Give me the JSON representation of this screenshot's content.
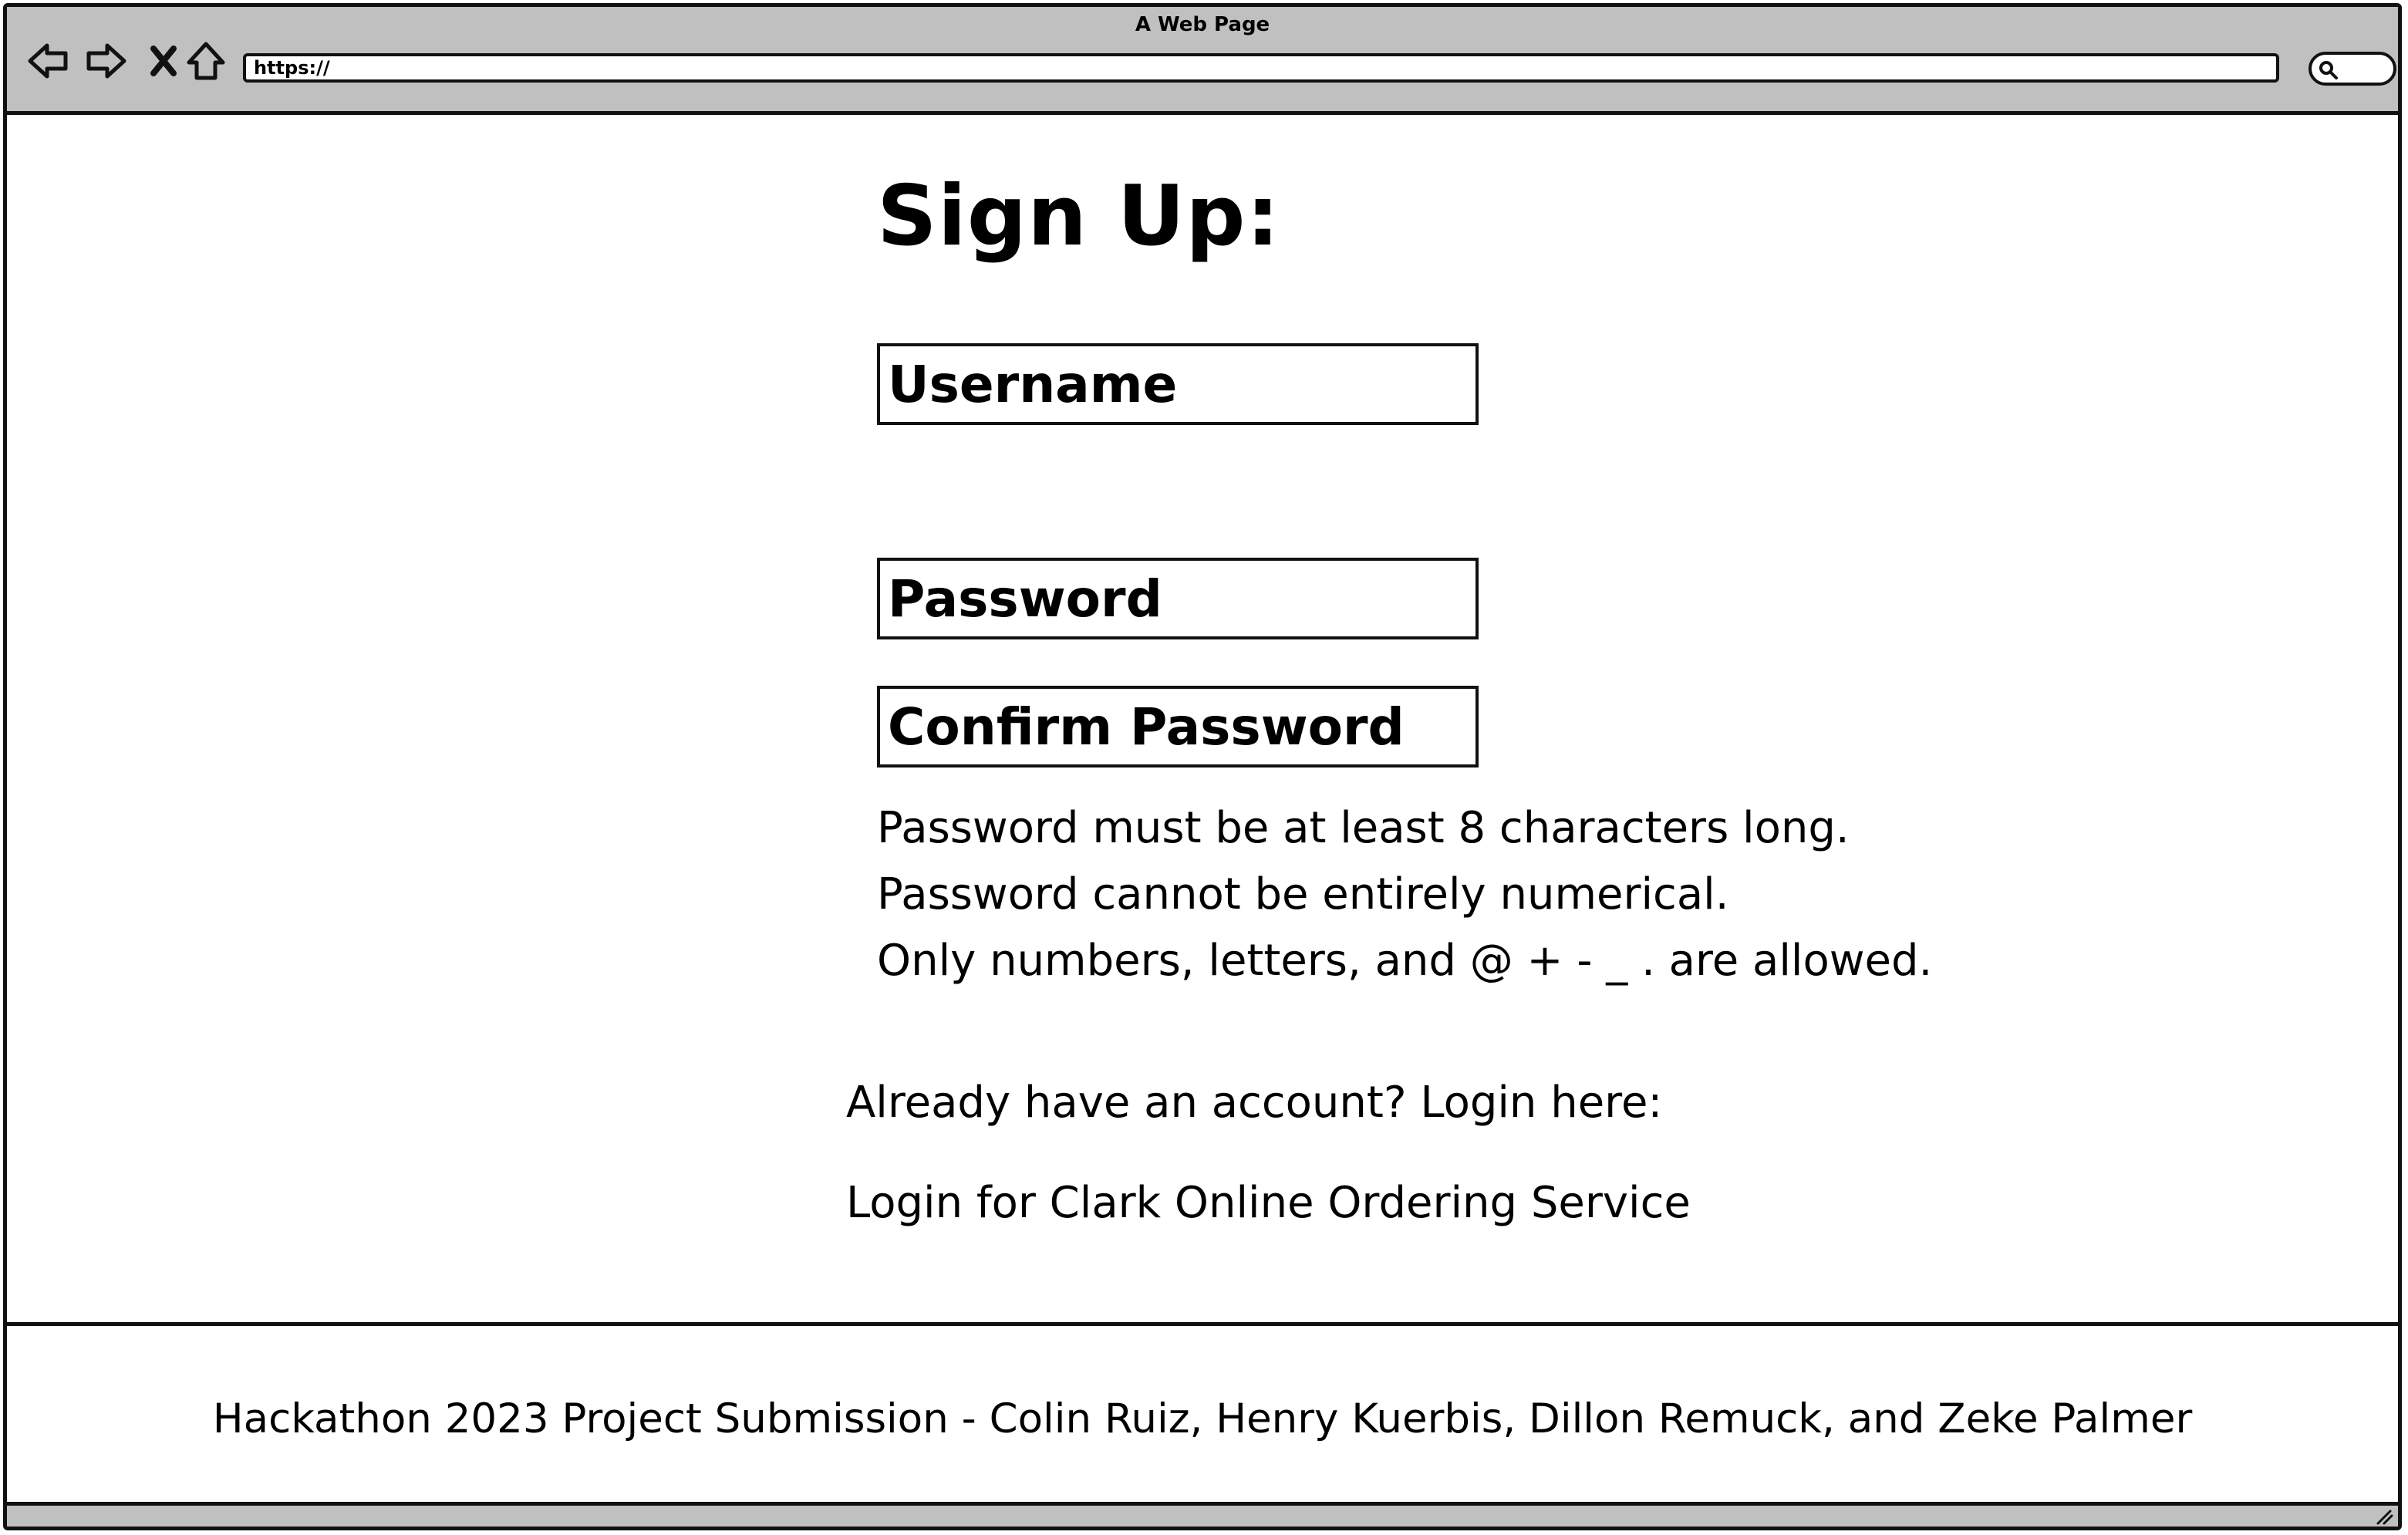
{
  "window": {
    "title": "A Web Page",
    "url": "https://"
  },
  "icons": {
    "back": "back-arrow-icon",
    "forward": "forward-arrow-icon",
    "stop": "close-icon",
    "home": "home-icon",
    "search": "search-icon",
    "resize": "resize-grip-icon"
  },
  "main": {
    "heading": "Sign Up:",
    "username_placeholder": "Username",
    "password_placeholder": "Password",
    "confirm_placeholder": "Confirm Password",
    "rules": [
      "Password must be at least 8 characters long.",
      "Password cannot be entirely numerical.",
      "Only numbers, letters, and @ + - _ . are allowed."
    ],
    "login_prompt": "Already have an account? Login here:",
    "login_link": "Login for Clark Online Ordering Service"
  },
  "footer": {
    "text": "Hackathon 2023 Project Submission - Colin Ruiz, Henry Kuerbis, Dillon Remuck, and Zeke Palmer"
  },
  "colors": {
    "chrome": "#c0c0c0",
    "border": "#111111",
    "background": "#ffffff"
  }
}
